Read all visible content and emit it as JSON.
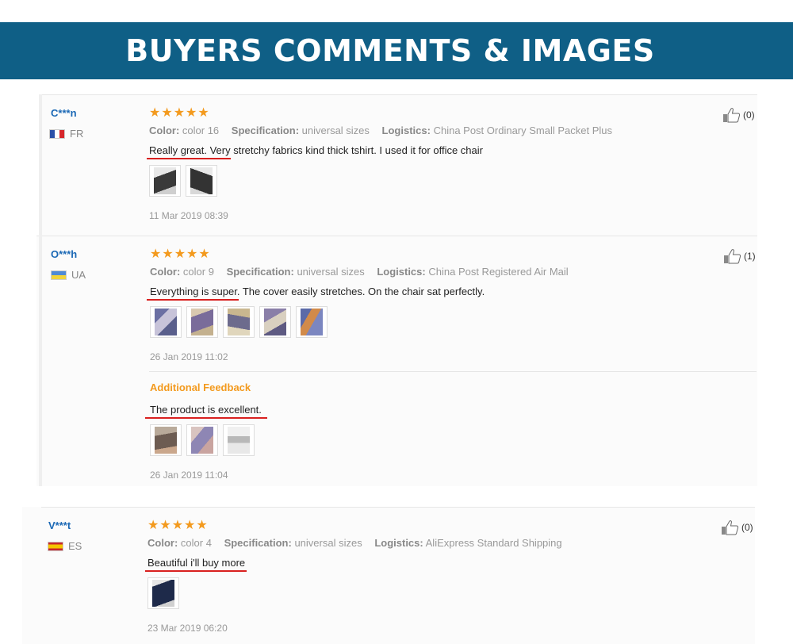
{
  "banner": {
    "title": "BUYERS COMMENTS & IMAGES"
  },
  "colors": {
    "banner_bg": "#0f5f86",
    "star": "#f39a1e",
    "name": "#1a68b5",
    "underline": "#d9201f",
    "additional_feedback": "#f39a1e"
  },
  "labels": {
    "color": "Color:",
    "specification": "Specification:",
    "logistics": "Logistics:",
    "additional_feedback": "Additional Feedback"
  },
  "reviews": [
    {
      "name": "C***n",
      "country": "FR",
      "flag": "flag-fr",
      "rating": 5,
      "color": "color 16",
      "specification": "universal sizes",
      "logistics": "China Post Ordinary Small Packet Plus",
      "comment": "Really great. Very stretchy fabrics kind thick tshirt. I used it for office chair",
      "photo_count": 2,
      "date": "11 Mar 2019 08:39",
      "likes": "(0)"
    },
    {
      "name": "O***h",
      "country": "UA",
      "flag": "flag-ua",
      "rating": 5,
      "color": "color 9",
      "specification": "universal sizes",
      "logistics": "China Post Registered Air Mail",
      "comment": "Everything is super. The cover easily stretches. On the chair sat perfectly.",
      "photo_count": 5,
      "date": "26 Jan 2019 11:02",
      "likes": "(1)",
      "additional": {
        "comment": "The product is excellent.",
        "photo_count": 3,
        "date": "26 Jan 2019 11:04"
      }
    },
    {
      "name": "V***t",
      "country": "ES",
      "flag": "flag-es",
      "rating": 5,
      "color": "color 4",
      "specification": "universal sizes",
      "logistics": "AliExpress Standard Shipping",
      "comment": "Beautiful i'll buy more",
      "photo_count": 1,
      "date": "23 Mar 2019 06:20",
      "likes": "(0)"
    }
  ]
}
